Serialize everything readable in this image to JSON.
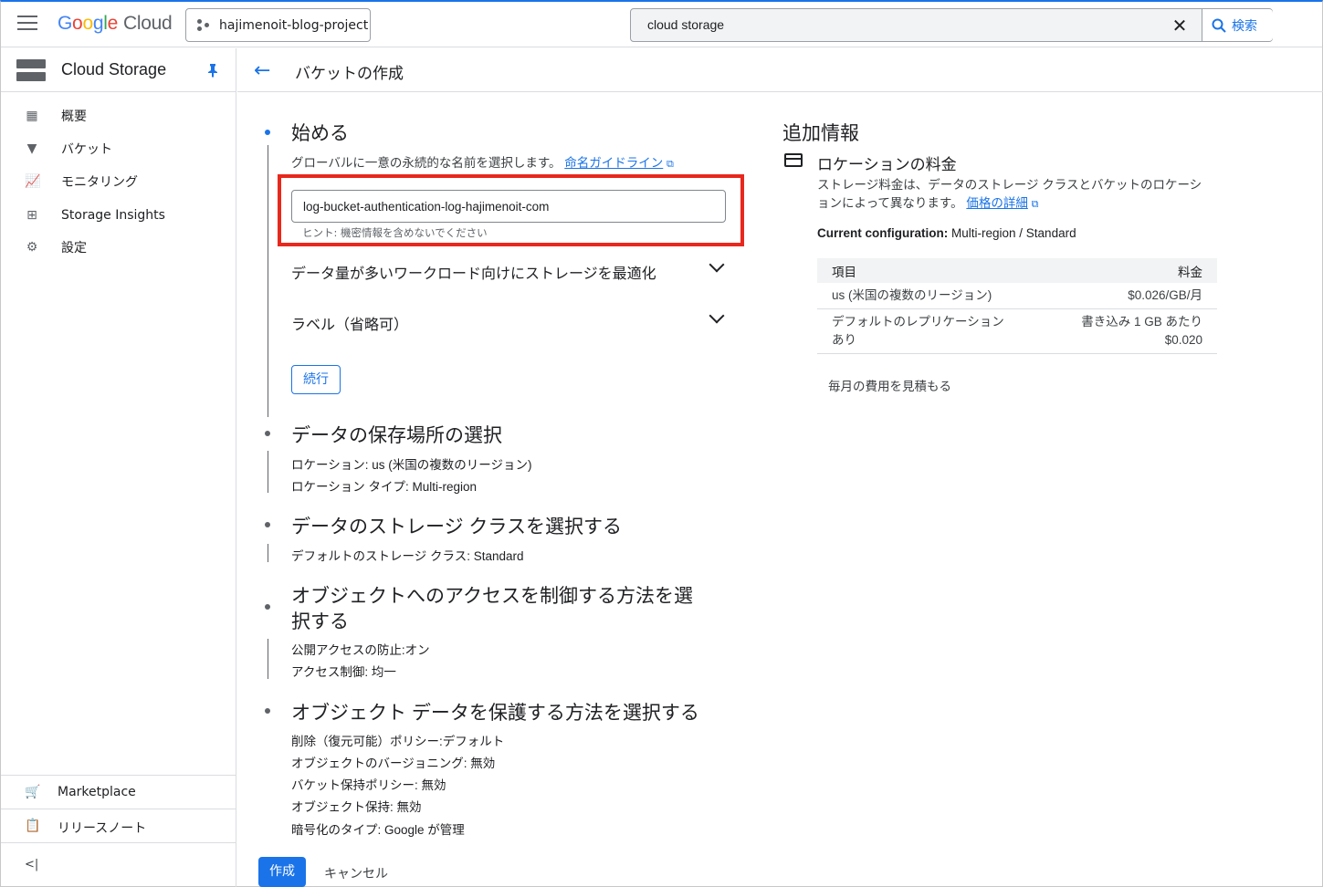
{
  "header": {
    "logo_google": "Google",
    "logo_cloud": "Cloud",
    "project": "hajimenoit-blog-project",
    "search_value": "cloud storage",
    "search_button": "検索"
  },
  "sidebar": {
    "title": "Cloud Storage",
    "items": [
      {
        "label": "概要",
        "icon": "overview-icon"
      },
      {
        "label": "バケット",
        "icon": "bucket-icon"
      },
      {
        "label": "モニタリング",
        "icon": "monitoring-icon"
      },
      {
        "label": "Storage Insights",
        "icon": "insights-icon"
      },
      {
        "label": "設定",
        "icon": "gear-icon"
      }
    ],
    "bottom": [
      {
        "label": "Marketplace",
        "icon": "cart-icon"
      },
      {
        "label": "リリースノート",
        "icon": "release-notes-icon"
      }
    ]
  },
  "page": {
    "title": "バケットの作成"
  },
  "steps": {
    "s1": {
      "title": "始める",
      "desc": "グローバルに一意の永続的な名前を選択します。",
      "link": "命名ガイドライン",
      "input_value": "log-bucket-authentication-log-hajimenoit-com",
      "hint": "ヒント: 機密情報を含めないでください",
      "expander1": "データ量が多いワークロード向けにストレージを最適化",
      "expander2": "ラベル（省略可）",
      "continue": "続行"
    },
    "s2": {
      "title": "データの保存場所の選択",
      "lines": [
        "ロケーション: us (米国の複数のリージョン)",
        "ロケーション タイプ: Multi-region"
      ]
    },
    "s3": {
      "title": "データのストレージ クラスを選択する",
      "lines": [
        "デフォルトのストレージ クラス: Standard"
      ]
    },
    "s4": {
      "title_line1": "オブジェクトへのアクセスを制御する方法を選",
      "title_line2": "択する",
      "lines": [
        "公開アクセスの防止:オン",
        "アクセス制御: 均一"
      ]
    },
    "s5": {
      "title": "オブジェクト データを保護する方法を選択する",
      "lines": [
        "削除（復元可能）ポリシー:デフォルト",
        "オブジェクトのバージョニング: 無効",
        "バケット保持ポリシー: 無効",
        "オブジェクト保持: 無効",
        "暗号化のタイプ: Google が管理"
      ]
    }
  },
  "actions": {
    "create": "作成",
    "cancel": "キャンセル"
  },
  "info": {
    "title": "追加情報",
    "subtitle": "ロケーションの料金",
    "desc_line1": "ストレージ料金は、データのストレージ クラスとバケットのロケーシ",
    "desc_line2": "ョンによって異なります。",
    "desc_link": "価格の詳細",
    "config_label": "Current configuration:",
    "config_value": "Multi-region / Standard",
    "table": {
      "headers": [
        "項目",
        "料金"
      ],
      "rows": [
        {
          "item": [
            "us (米国の複数のリージョン)"
          ],
          "price": [
            "$0.026/GB/月"
          ]
        },
        {
          "item": [
            "デフォルトのレプリケーション",
            "あり"
          ],
          "price": [
            "書き込み 1 GB あたり",
            "$0.020"
          ]
        }
      ]
    },
    "estimate": "毎月の費用を見積もる"
  },
  "colors": {
    "accent": "#1a73e8",
    "highlight": "#e8281d"
  }
}
